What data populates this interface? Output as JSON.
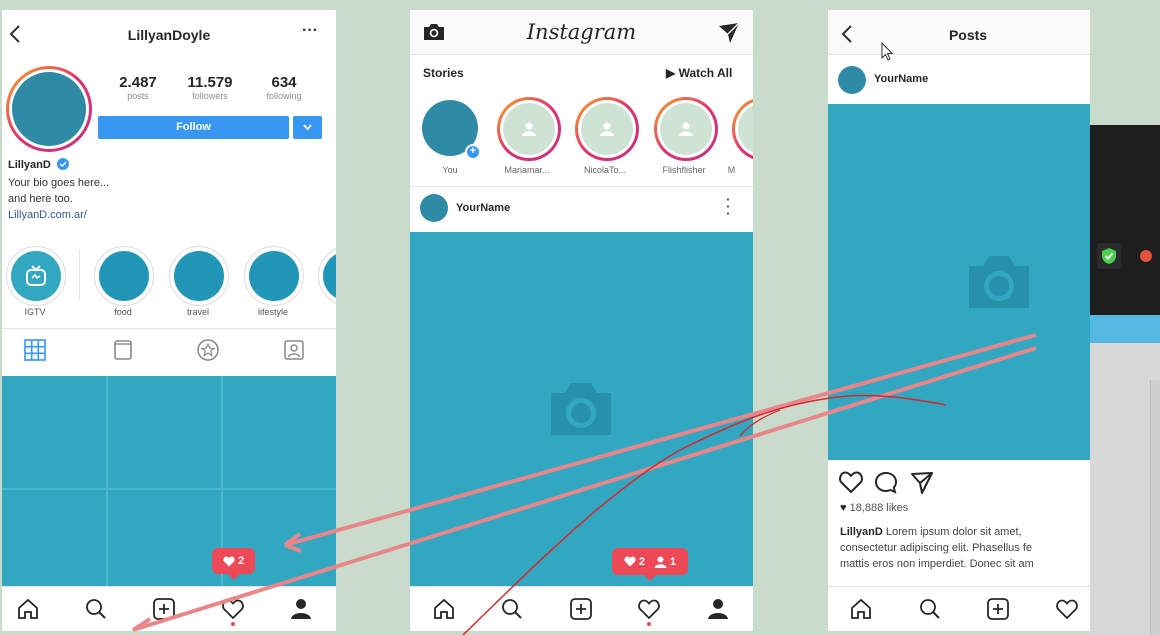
{
  "profile": {
    "username": "LillyanDoyle",
    "stats": [
      {
        "value": "2.487",
        "label": "posts"
      },
      {
        "value": "11.579",
        "label": "followers"
      },
      {
        "value": "634",
        "label": "following"
      }
    ],
    "follow_label": "Follow",
    "name": "LillyanD",
    "bio_line1": "Your bio goes here...",
    "bio_line2": "and here too.",
    "link": "LillyanD.com.ar/",
    "highlights": [
      "IGTV",
      "food",
      "travel",
      "lifestyle"
    ],
    "notif_likes": "2"
  },
  "feed": {
    "logo": "Instagram",
    "stories_label": "Stories",
    "watch_all": "▶ Watch All",
    "stories": [
      "You",
      "Mariamar...",
      "NicolaTo...",
      "Flishflisher",
      "M"
    ],
    "post_user": "YourName",
    "notif_likes": "2",
    "notif_follows": "1"
  },
  "post": {
    "title": "Posts",
    "user": "YourName",
    "likes": "18,888 likes",
    "caption_user": "LillyanD",
    "caption_line1": "Lorem ipsum dolor sit amet,",
    "caption_line2": "consectetur adipiscing elit. Phasellus fe",
    "caption_line3": "mattis eros non imperdiet. Donec sit am"
  },
  "colors": {
    "accent": "#3897f0",
    "teal": "#31a7c1",
    "badge": "#ed4956",
    "background": "#c9dccb"
  },
  "icons": [
    "back-arrow-icon",
    "more-icon",
    "camera-icon",
    "send-icon",
    "home-icon",
    "search-icon",
    "add-icon",
    "heart-icon",
    "user-icon",
    "grid-icon",
    "igtv-icon",
    "tag-icon",
    "comment-icon",
    "verified-icon",
    "menu-icon"
  ]
}
